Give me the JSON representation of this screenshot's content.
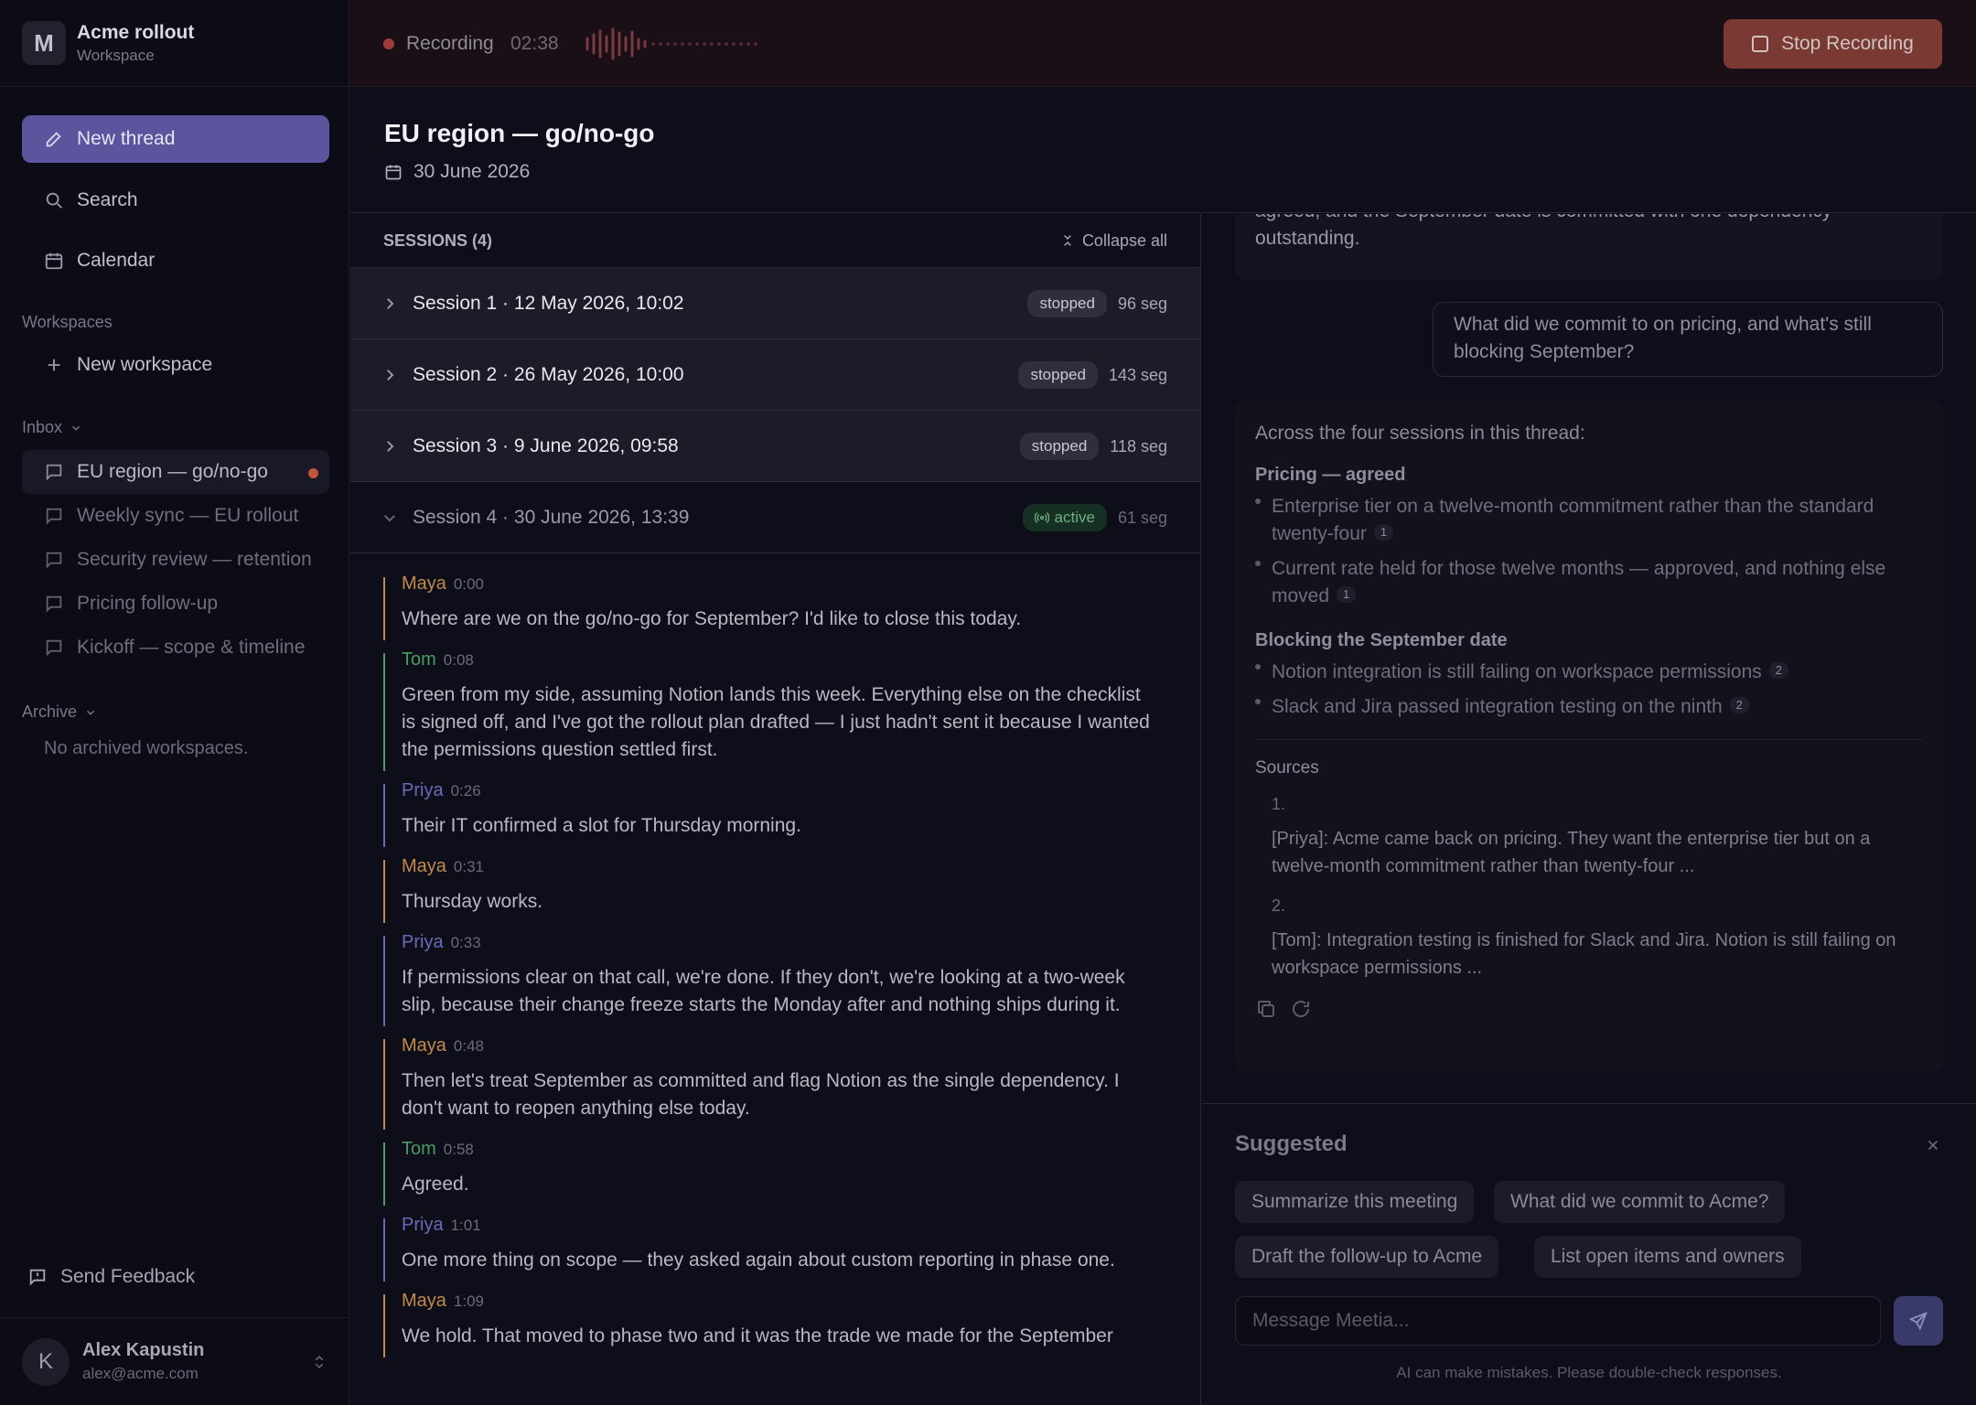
{
  "workspace": {
    "initial": "M",
    "name": "Acme rollout",
    "subtitle": "Workspace"
  },
  "sidebar": {
    "new_thread": "New thread",
    "search": "Search",
    "calendar": "Calendar",
    "workspaces_label": "Workspaces",
    "new_workspace": "New workspace",
    "inbox_label": "Inbox",
    "threads": [
      {
        "label": "EU region — go/no-go",
        "active": true,
        "unread": true
      },
      {
        "label": "Weekly sync — EU rollout"
      },
      {
        "label": "Security review — retention"
      },
      {
        "label": "Pricing follow-up"
      },
      {
        "label": "Kickoff — scope & timeline"
      }
    ],
    "archive_label": "Archive",
    "no_archived": "No archived workspaces.",
    "send_feedback": "Send Feedback"
  },
  "user": {
    "initial": "K",
    "name": "Alex Kapustin",
    "email": "alex@acme.com"
  },
  "recording": {
    "label": "Recording",
    "time": "02:38",
    "stop_label": "Stop Recording",
    "color": "#a03a3a"
  },
  "page": {
    "title": "EU region — go/no-go",
    "date": "30 June 2026"
  },
  "sessions": {
    "header": "SESSIONS (4)",
    "collapse_all": "Collapse all",
    "items": [
      {
        "label": "Session 1 · 12 May 2026, 10:02",
        "status": "stopped",
        "segs": "96 seg"
      },
      {
        "label": "Session 2 · 26 May 2026, 10:00",
        "status": "stopped",
        "segs": "143 seg"
      },
      {
        "label": "Session 3 · 9 June 2026, 09:58",
        "status": "stopped",
        "segs": "118 seg"
      },
      {
        "label": "Session 4 · 30 June 2026, 13:39",
        "status": "active",
        "segs": "61 seg"
      }
    ]
  },
  "transcript": [
    {
      "speaker": "Maya",
      "time": "0:00",
      "text": "Where are we on the go/no-go for September? I'd like to close this today.",
      "color": "#c08a4a"
    },
    {
      "speaker": "Tom",
      "time": "0:08",
      "text": "Green from my side, assuming Notion lands this week. Everything else on the checklist is signed off, and I've got the rollout plan drafted — I just hadn't sent it because I wanted the permissions question settled first.",
      "color": "#4a9a62"
    },
    {
      "speaker": "Priya",
      "time": "0:26",
      "text": "Their IT confirmed a slot for Thursday morning.",
      "color": "#6a6ab8"
    },
    {
      "speaker": "Maya",
      "time": "0:31",
      "text": "Thursday works.",
      "color": "#c08a4a"
    },
    {
      "speaker": "Priya",
      "time": "0:33",
      "text": "If permissions clear on that call, we're done. If they don't, we're looking at a two-week slip, because their change freeze starts the Monday after and nothing ships during it.",
      "color": "#6a6ab8"
    },
    {
      "speaker": "Maya",
      "time": "0:48",
      "text": "Then let's treat September as committed and flag Notion as the single dependency. I don't want to reopen anything else today.",
      "color": "#c08a4a"
    },
    {
      "speaker": "Tom",
      "time": "0:58",
      "text": "Agreed.",
      "color": "#4a9a62"
    },
    {
      "speaker": "Priya",
      "time": "1:01",
      "text": "One more thing on scope — they asked again about custom reporting in phase one.",
      "color": "#6a6ab8"
    },
    {
      "speaker": "Maya",
      "time": "1:09",
      "text": "We hold. That moved to phase two and it was the trade we made for the September",
      "color": "#c08a4a"
    }
  ],
  "chat": {
    "prev_answer_tail": "agreed, and the September date is committed with one dependency outstanding.",
    "user_question": "What did we commit to on pricing, and what's still blocking September?",
    "answer": {
      "intro": "Across the four sessions in this thread:",
      "sections": [
        {
          "heading": "Pricing — agreed",
          "items": [
            {
              "text": "Enterprise tier on a twelve-month commitment rather than the standard twenty-four",
              "cite": "1"
            },
            {
              "text": "Current rate held for those twelve months — approved, and nothing else moved",
              "cite": "1"
            }
          ]
        },
        {
          "heading": "Blocking the September date",
          "items": [
            {
              "text": "Notion integration is still failing on workspace permissions",
              "cite": "2"
            },
            {
              "text": "Slack and Jira passed integration testing on the ninth",
              "cite": "2"
            }
          ]
        }
      ],
      "sources_label": "Sources",
      "sources": [
        {
          "num": "1.",
          "text": "[Priya]: Acme came back on pricing. They want the enterprise tier but on a twelve-month commitment rather than twenty-four ..."
        },
        {
          "num": "2.",
          "text": "[Tom]: Integration testing is finished for Slack and Jira. Notion is still failing on workspace permissions ..."
        }
      ]
    }
  },
  "suggested": {
    "title": "Suggested",
    "chips": [
      "Summarize this meeting",
      "What did we commit to Acme?",
      "Draft the follow-up to Acme",
      "List open items and owners"
    ],
    "input_placeholder": "Message Meetia...",
    "disclaimer": "AI can make mistakes. Please double-check responses."
  }
}
